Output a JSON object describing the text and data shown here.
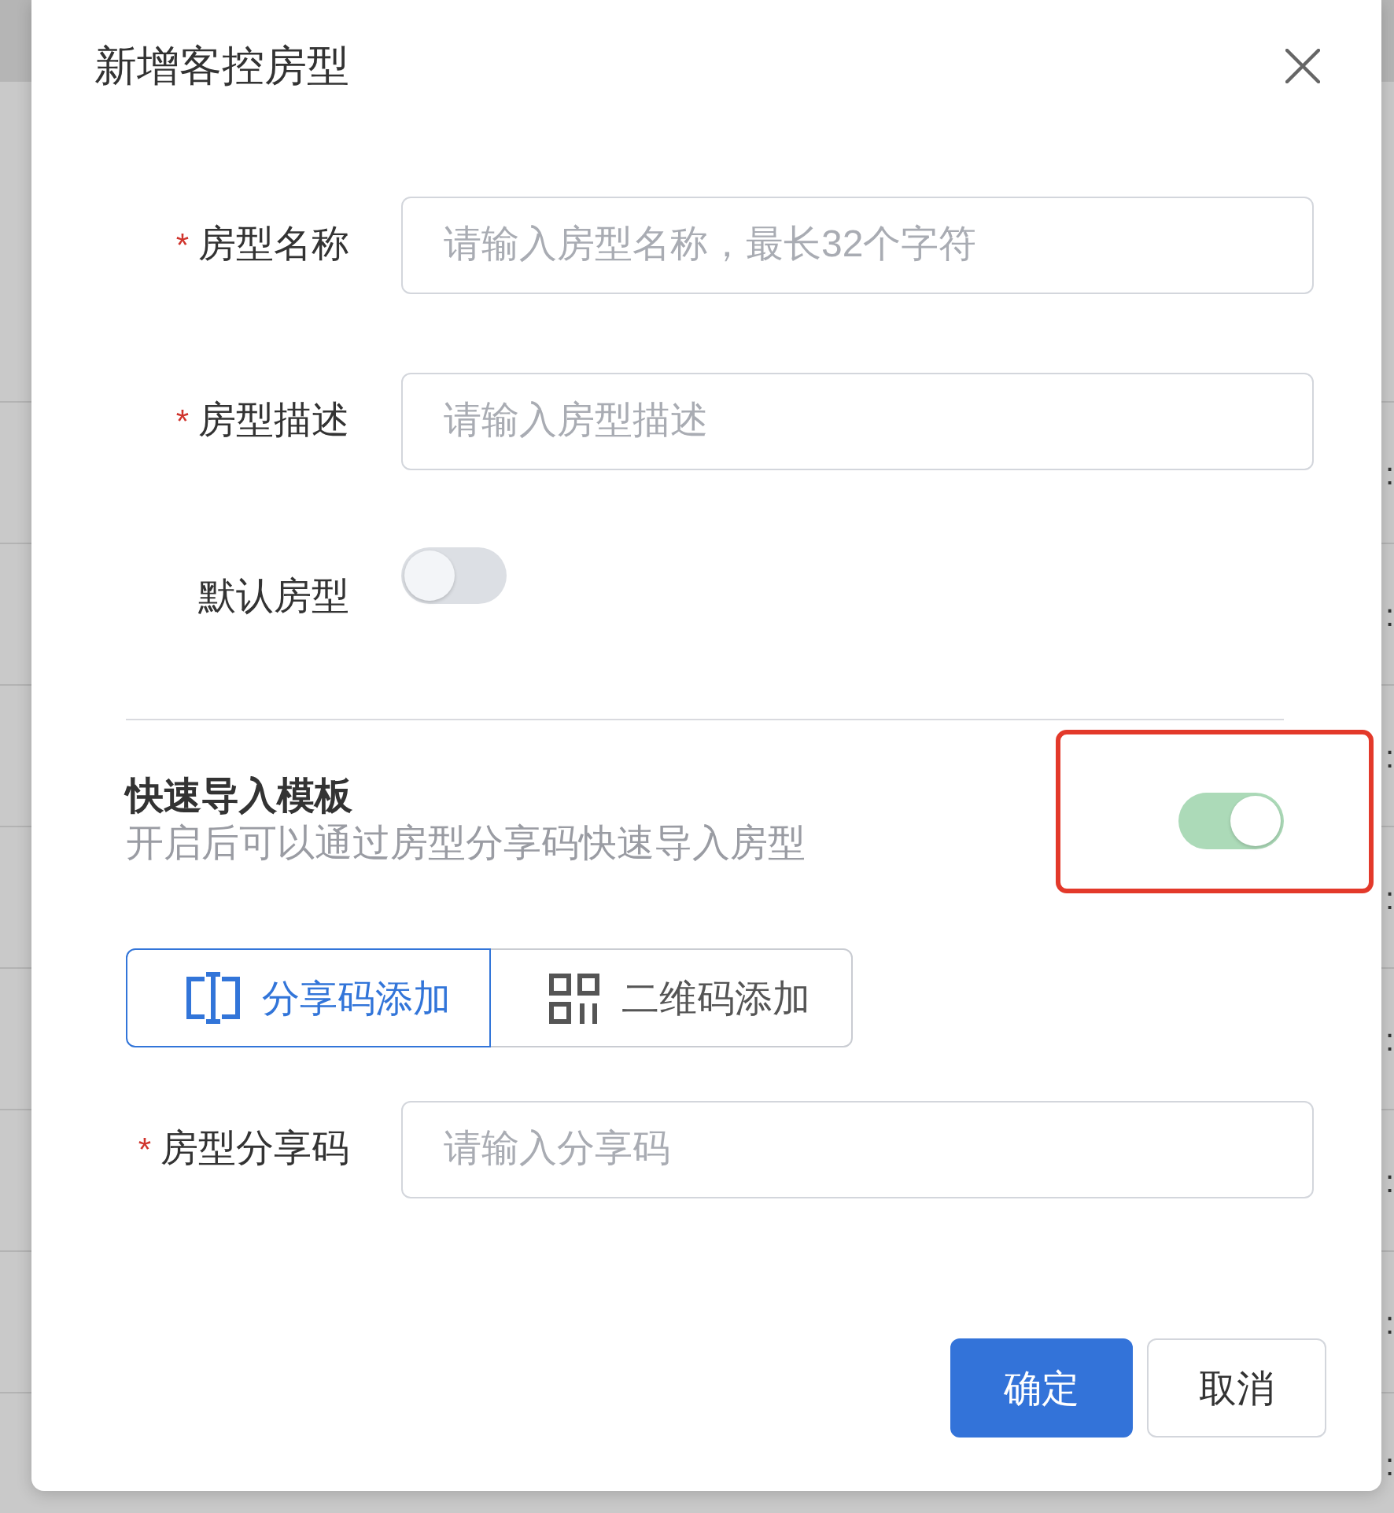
{
  "dialog": {
    "title": "新增客控房型"
  },
  "form_fields": [
    {
      "kind": "input",
      "required_mark": "*",
      "label": "房型名称",
      "placeholder": "请输入房型名称，最长32个字符"
    },
    {
      "kind": "input",
      "required_mark": "*",
      "label": "房型描述",
      "placeholder": "请输入房型描述"
    },
    {
      "kind": "switch",
      "label": "默认房型",
      "on": false
    }
  ],
  "quick_import": {
    "title": "快速导入模板",
    "description": "开启后可以通过房型分享码快速导入房型",
    "on": true,
    "highlighted": true
  },
  "add_mode_tabs": [
    {
      "label": "分享码添加",
      "selected": true
    },
    {
      "label": "二维码添加",
      "selected": false
    }
  ],
  "share_code_field": {
    "required_mark": "*",
    "label": "房型分享码",
    "placeholder": "请输入分享码"
  },
  "buttons": [
    {
      "kind": "primary",
      "label": "确定"
    },
    {
      "kind": "default",
      "label": "取消"
    }
  ],
  "background_rows": [
    ":",
    ":",
    ":",
    ":",
    ":",
    ":",
    ":",
    ":"
  ]
}
